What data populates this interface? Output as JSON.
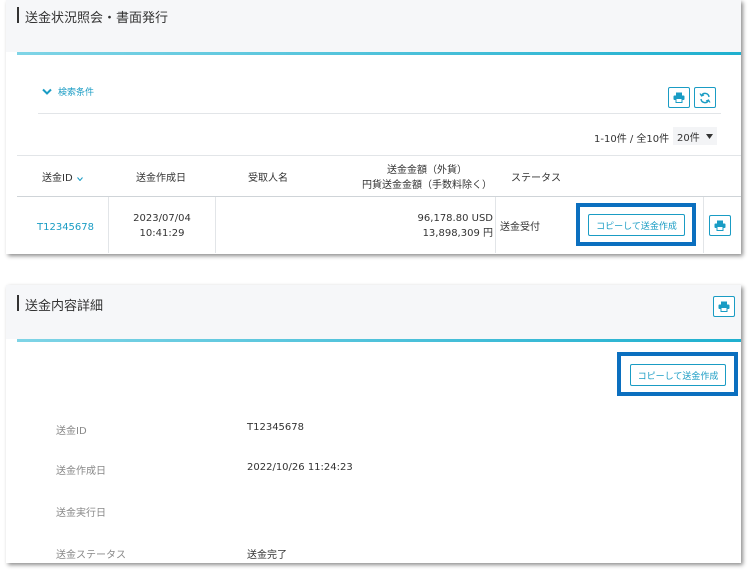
{
  "top_panel": {
    "title": "送金状況照会・書面発行",
    "search_toggle_label": "検索条件",
    "pagination_text": "1-10件 / 全10件",
    "page_size_value": "20件",
    "columns": {
      "remittance_id": "送金ID",
      "created_date": "送金作成日",
      "recipient": "受取人名",
      "amount_line1": "送金金額（外貨）",
      "amount_line2": "円貨送金金額（手数料除く）",
      "status": "ステータス"
    },
    "rows": [
      {
        "remittance_id": "T12345678",
        "created_date": "2023/07/04",
        "created_time": "10:41:29",
        "recipient": "",
        "amount_foreign": "96,178.80 USD",
        "amount_yen": "13,898,309 円",
        "status": "送金受付",
        "copy_button_label": "コピーして送金作成"
      }
    ]
  },
  "bottom_panel": {
    "title": "送金内容詳細",
    "copy_button_label": "コピーして送金作成",
    "fields": [
      {
        "label": "送金ID",
        "value": "T12345678"
      },
      {
        "label": "送金作成日",
        "value": "2022/10/26 11:24:23"
      },
      {
        "label": "送金実行日",
        "value": ""
      },
      {
        "label": "送金ステータス",
        "value": "送金完了"
      }
    ]
  },
  "colors": {
    "accent": "#1a9cc4",
    "highlight": "#0b6fbf",
    "header_bg": "#f6f7f9"
  },
  "icons": [
    "print-icon",
    "refresh-icon",
    "chevron-down-icon",
    "sort-down-icon",
    "dropdown-caret-icon"
  ]
}
